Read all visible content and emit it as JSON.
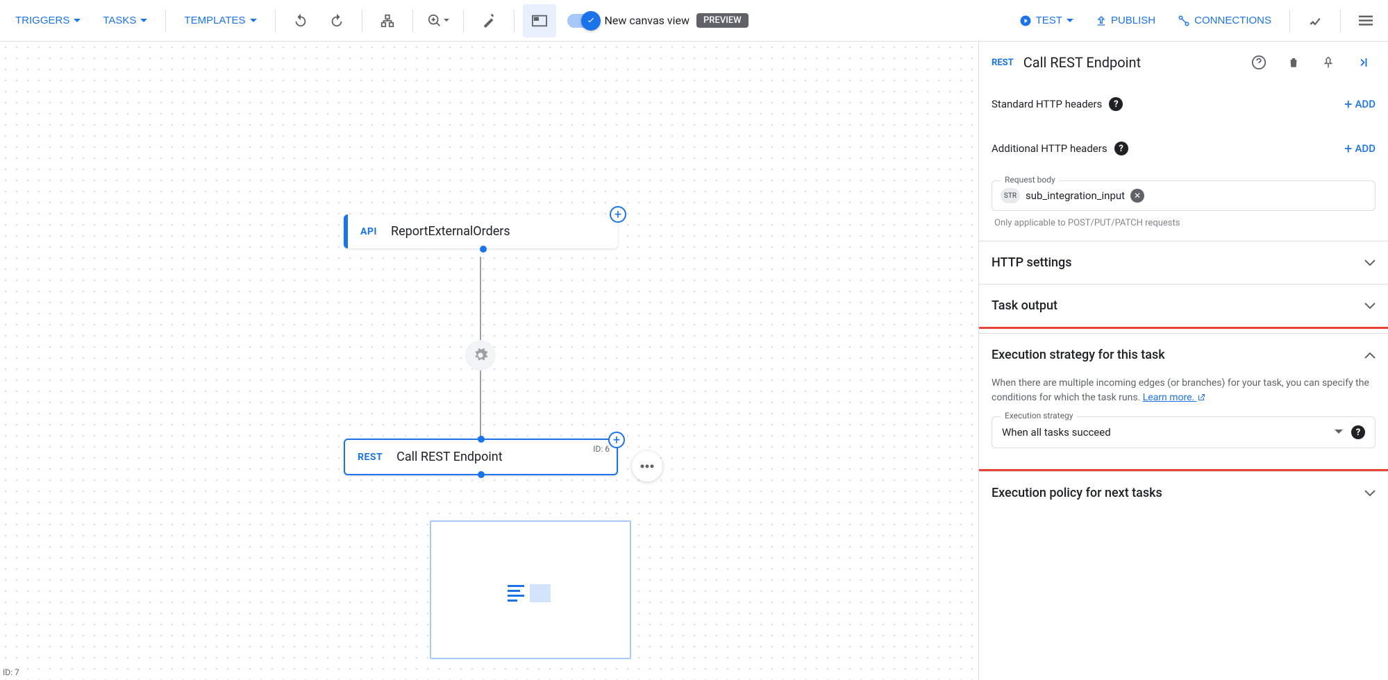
{
  "toolbar": {
    "triggers": "TRIGGERS",
    "tasks": "TASKS",
    "templates": "TEMPLATES",
    "new_canvas": "New canvas view",
    "preview": "PREVIEW",
    "test": "TEST",
    "publish": "PUBLISH",
    "connections": "CONNECTIONS"
  },
  "canvas": {
    "bottom_id": "ID: 7",
    "trigger": {
      "badge": "API",
      "label": "ReportExternalOrders"
    },
    "task": {
      "badge": "REST",
      "label": "Call REST Endpoint",
      "id": "ID: 6"
    }
  },
  "panel": {
    "badge": "REST",
    "title": "Call REST Endpoint",
    "std_headers": "Standard HTTP headers",
    "add_headers": "Additional HTTP headers",
    "add": "ADD",
    "body": {
      "legend": "Request body",
      "type": "STR",
      "value": "sub_integration_input",
      "hint": "Only applicable to POST/PUT/PATCH requests"
    },
    "http_settings": "HTTP settings",
    "task_output": "Task output",
    "exec_strategy": {
      "title": "Execution strategy for this task",
      "desc": "When there are multiple incoming edges (or branches) for your task, you can specify the conditions for which the task runs. ",
      "learn": "Learn more.",
      "legend": "Execution strategy",
      "value": "When all tasks succeed"
    },
    "exec_policy": "Execution policy for next tasks"
  }
}
